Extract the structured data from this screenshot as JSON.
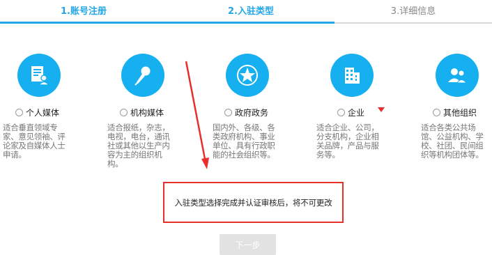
{
  "steps": [
    {
      "label": "1.账号注册"
    },
    {
      "label": "2.入驻类型"
    },
    {
      "label": "3.详细信息"
    }
  ],
  "types": [
    {
      "icon": "document-user-icon",
      "label": "个人媒体",
      "desc": "适合垂直领域专家、意见领袖、评论家及自媒体人士申请。"
    },
    {
      "icon": "microphone-icon",
      "label": "机构媒体",
      "desc": "适合报纸，杂志，电视，电台，通讯社或其他以生产内容为主的组织机构。"
    },
    {
      "icon": "star-emblem-icon",
      "label": "政府政务",
      "desc": "国内外、各级、各类政府机构、事业单位、具有行政职能的社会组织等。"
    },
    {
      "icon": "building-icon",
      "label": "企业",
      "desc": "适合企业、公司，分支机构，企业相关品牌，产品与服务等。"
    },
    {
      "icon": "group-users-icon",
      "label": "其他组织",
      "desc": "适合各类公共场馆、公益机构、学校、社团、民间组织等机构团体等。"
    }
  ],
  "notice": {
    "text": "入驻类型选择完成并认证审核后，将不可更改"
  },
  "next_button": {
    "label": "下一步"
  },
  "colors": {
    "accent": "#22a6e8",
    "icon_bg": "#16b0f0",
    "highlight_red": "#e8302a",
    "disabled_button": "#e2e2e2"
  }
}
